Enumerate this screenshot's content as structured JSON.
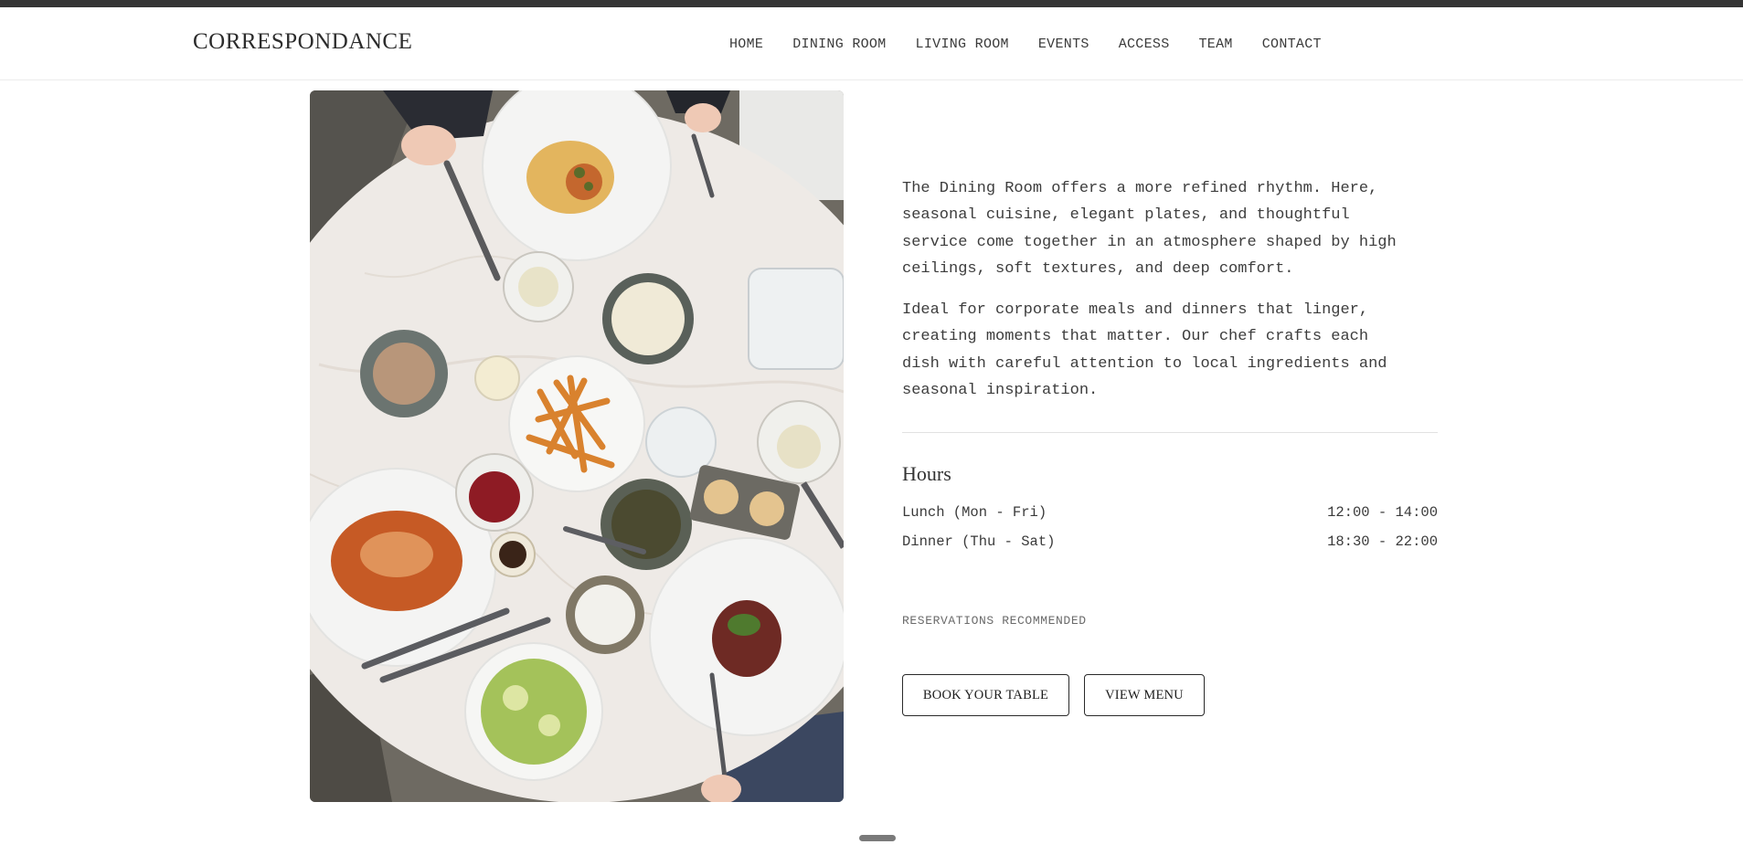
{
  "brand": {
    "logo": "CORRESPONDANCE"
  },
  "nav": {
    "items": [
      {
        "label": "HOME"
      },
      {
        "label": "DINING ROOM"
      },
      {
        "label": "LIVING ROOM"
      },
      {
        "label": "EVENTS"
      },
      {
        "label": "ACCESS"
      },
      {
        "label": "TEAM"
      },
      {
        "label": "CONTACT"
      }
    ]
  },
  "main": {
    "image_subject": "overhead view of a marble dining table with plates of food",
    "paragraph_1_lines": [
      "The Dining Room offers a more refined rhythm. Here,",
      "seasonal cuisine, elegant plates, and thoughtful",
      "service come together in an atmosphere shaped by high",
      "ceilings, soft textures, and deep comfort."
    ],
    "paragraph_2_lines": [
      "Ideal for corporate meals and dinners that linger,",
      "creating moments that matter. Our chef crafts each",
      "dish with careful attention to local ingredients and",
      "seasonal inspiration."
    ],
    "hours": {
      "title": "Hours",
      "rows": [
        {
          "day": "Lunch (Mon - Fri)",
          "time": "12:00 - 14:00"
        },
        {
          "day": "Dinner (Thu - Sat)",
          "time": "18:30 - 22:00"
        }
      ]
    },
    "note": "RESERVATIONS RECOMMENDED",
    "buttons": {
      "book": "BOOK YOUR TABLE",
      "menu": "VIEW MENU"
    }
  },
  "colors": {
    "topbar": "#343434",
    "text": "#3a3a3a",
    "border": "#2a2a2a",
    "marble": "#eeeae6"
  }
}
